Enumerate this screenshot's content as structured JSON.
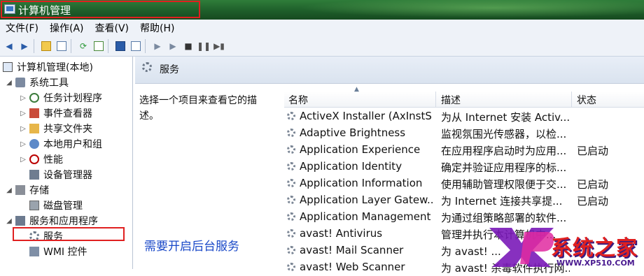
{
  "window": {
    "title": "计算机管理"
  },
  "menu": [
    "文件(F)",
    "操作(A)",
    "查看(V)",
    "帮助(H)"
  ],
  "toolbar": {
    "buttons": [
      "back-icon",
      "forward-icon",
      "up-folder-icon",
      "show-hide-tree-icon",
      "refresh-icon",
      "export-icon",
      "help-icon",
      "properties-icon",
      "play-icon",
      "play-alt-icon",
      "stop-icon",
      "pause-icon",
      "restart-icon"
    ]
  },
  "tree": {
    "root": "计算机管理(本地)",
    "system_tools": "系统工具",
    "task_scheduler": "任务计划程序",
    "event_viewer": "事件查看器",
    "shared_folders": "共享文件夹",
    "local_users": "本地用户和组",
    "performance": "性能",
    "device_manager": "设备管理器",
    "storage": "存储",
    "disk_management": "磁盘管理",
    "services_apps": "服务和应用程序",
    "services": "服务",
    "wmi": "WMI 控件"
  },
  "pane": {
    "title": "服务",
    "description": "选择一个项目来查看它的描述。",
    "hint": "需要开启后台服务"
  },
  "table": {
    "headers": {
      "name": "名称",
      "description": "描述",
      "status": "状态"
    },
    "rows": [
      {
        "name": "ActiveX Installer (AxInstS...",
        "description": "为从 Internet 安装 Activ...",
        "status": ""
      },
      {
        "name": "Adaptive Brightness",
        "description": "监视氛围光传感器，以检...",
        "status": ""
      },
      {
        "name": "Application Experience",
        "description": "在应用程序启动时为应用...",
        "status": "已启动"
      },
      {
        "name": "Application Identity",
        "description": "确定并验证应用程序的标...",
        "status": ""
      },
      {
        "name": "Application Information",
        "description": "使用辅助管理权限便于交...",
        "status": "已启动"
      },
      {
        "name": "Application Layer Gatew...",
        "description": "为 Internet 连接共享提...",
        "status": "已启动"
      },
      {
        "name": "Application Management",
        "description": "为通过组策略部署的软件...",
        "status": ""
      },
      {
        "name": "avast! Antivirus",
        "description": "管理并执行本计算机中...",
        "status": ""
      },
      {
        "name": "avast! Mail Scanner",
        "description": "为 avast! ...",
        "status": ""
      },
      {
        "name": "avast! Web Scanner",
        "description": "为 avast! 杀毒软件执行网...",
        "status": ""
      }
    ]
  },
  "watermark": {
    "brand": "系统之家",
    "site": "WWW.XP510.COM"
  }
}
